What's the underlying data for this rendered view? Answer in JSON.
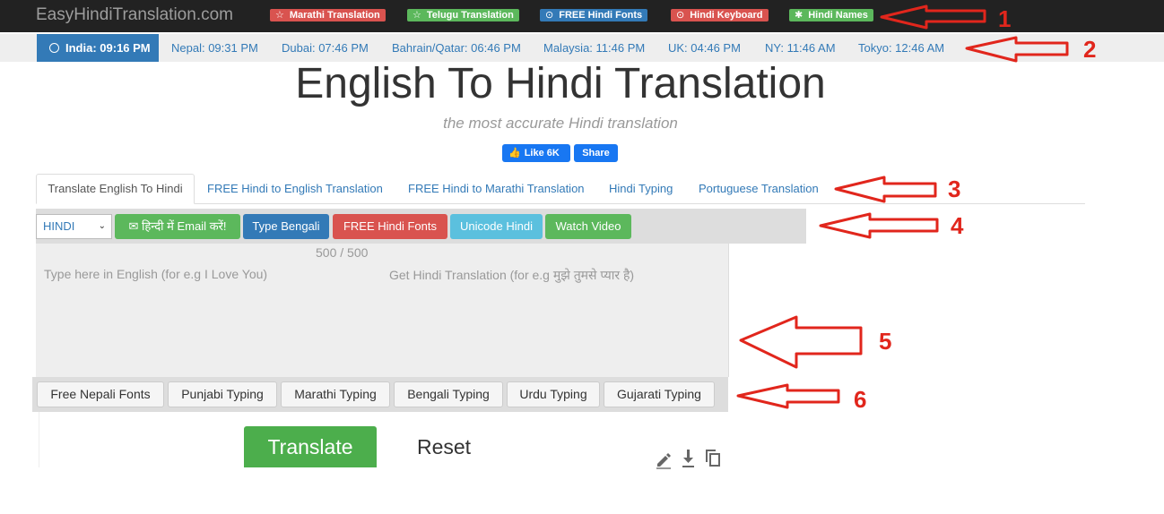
{
  "brand": "EasyHindiTranslation.com",
  "top_links": [
    {
      "label": "Marathi Translation",
      "icon": "star-icon",
      "color": "#d9534f"
    },
    {
      "label": "Telugu Translation",
      "icon": "star-icon",
      "color": "#5cb85c"
    },
    {
      "label": "FREE Hindi Fonts",
      "icon": "download-icon",
      "color": "#337ab7"
    },
    {
      "label": "Hindi Keyboard",
      "icon": "download-icon",
      "color": "#d9534f"
    },
    {
      "label": "Hindi Names",
      "icon": "asterisk-icon",
      "color": "#5cb85c"
    }
  ],
  "times": {
    "active": "India: 09:16 PM",
    "items": [
      "Nepal: 09:31 PM",
      "Dubai: 07:46 PM",
      "Bahrain/Qatar: 06:46 PM",
      "Malaysia: 11:46 PM",
      "UK: 04:46 PM",
      "NY: 11:46 AM",
      "Tokyo: 12:46 AM"
    ]
  },
  "title": "English To Hindi Translation",
  "subtitle": "the most accurate Hindi translation",
  "facebook": {
    "like": "Like 6K",
    "share": "Share"
  },
  "tabs": {
    "active": "Translate English To Hindi",
    "items": [
      "FREE Hindi to English Translation",
      "FREE Hindi to Marathi Translation",
      "Hindi Typing",
      "Portuguese Translation"
    ]
  },
  "toolbar": {
    "language_select": "HINDI",
    "buttons": [
      {
        "label": "✉ हिन्दी में Email करें!",
        "color": "#5cb85c"
      },
      {
        "label": "Type Bengali",
        "color": "#337ab7"
      },
      {
        "label": "FREE Hindi Fonts",
        "color": "#d9534f"
      },
      {
        "label": "Unicode Hindi",
        "color": "#5bc0de"
      },
      {
        "label": "Watch Video",
        "color": "#5cb85c"
      }
    ]
  },
  "editor": {
    "char_counter": "500 / 500",
    "input_placeholder": "Type here in English (for e.g I Love You)",
    "output_placeholder": "Get Hindi Translation (for e.g मुझे तुमसे प्यार है)"
  },
  "typing_links": [
    "Free Nepali Fonts",
    "Punjabi Typing",
    "Marathi Typing",
    "Bengali Typing",
    "Urdu Typing",
    "Gujarati Typing"
  ],
  "actions": {
    "translate": "Translate",
    "reset": "Reset"
  },
  "annotations": [
    "1",
    "2",
    "3",
    "4",
    "5",
    "6"
  ],
  "annotation_color": "#e1261c"
}
